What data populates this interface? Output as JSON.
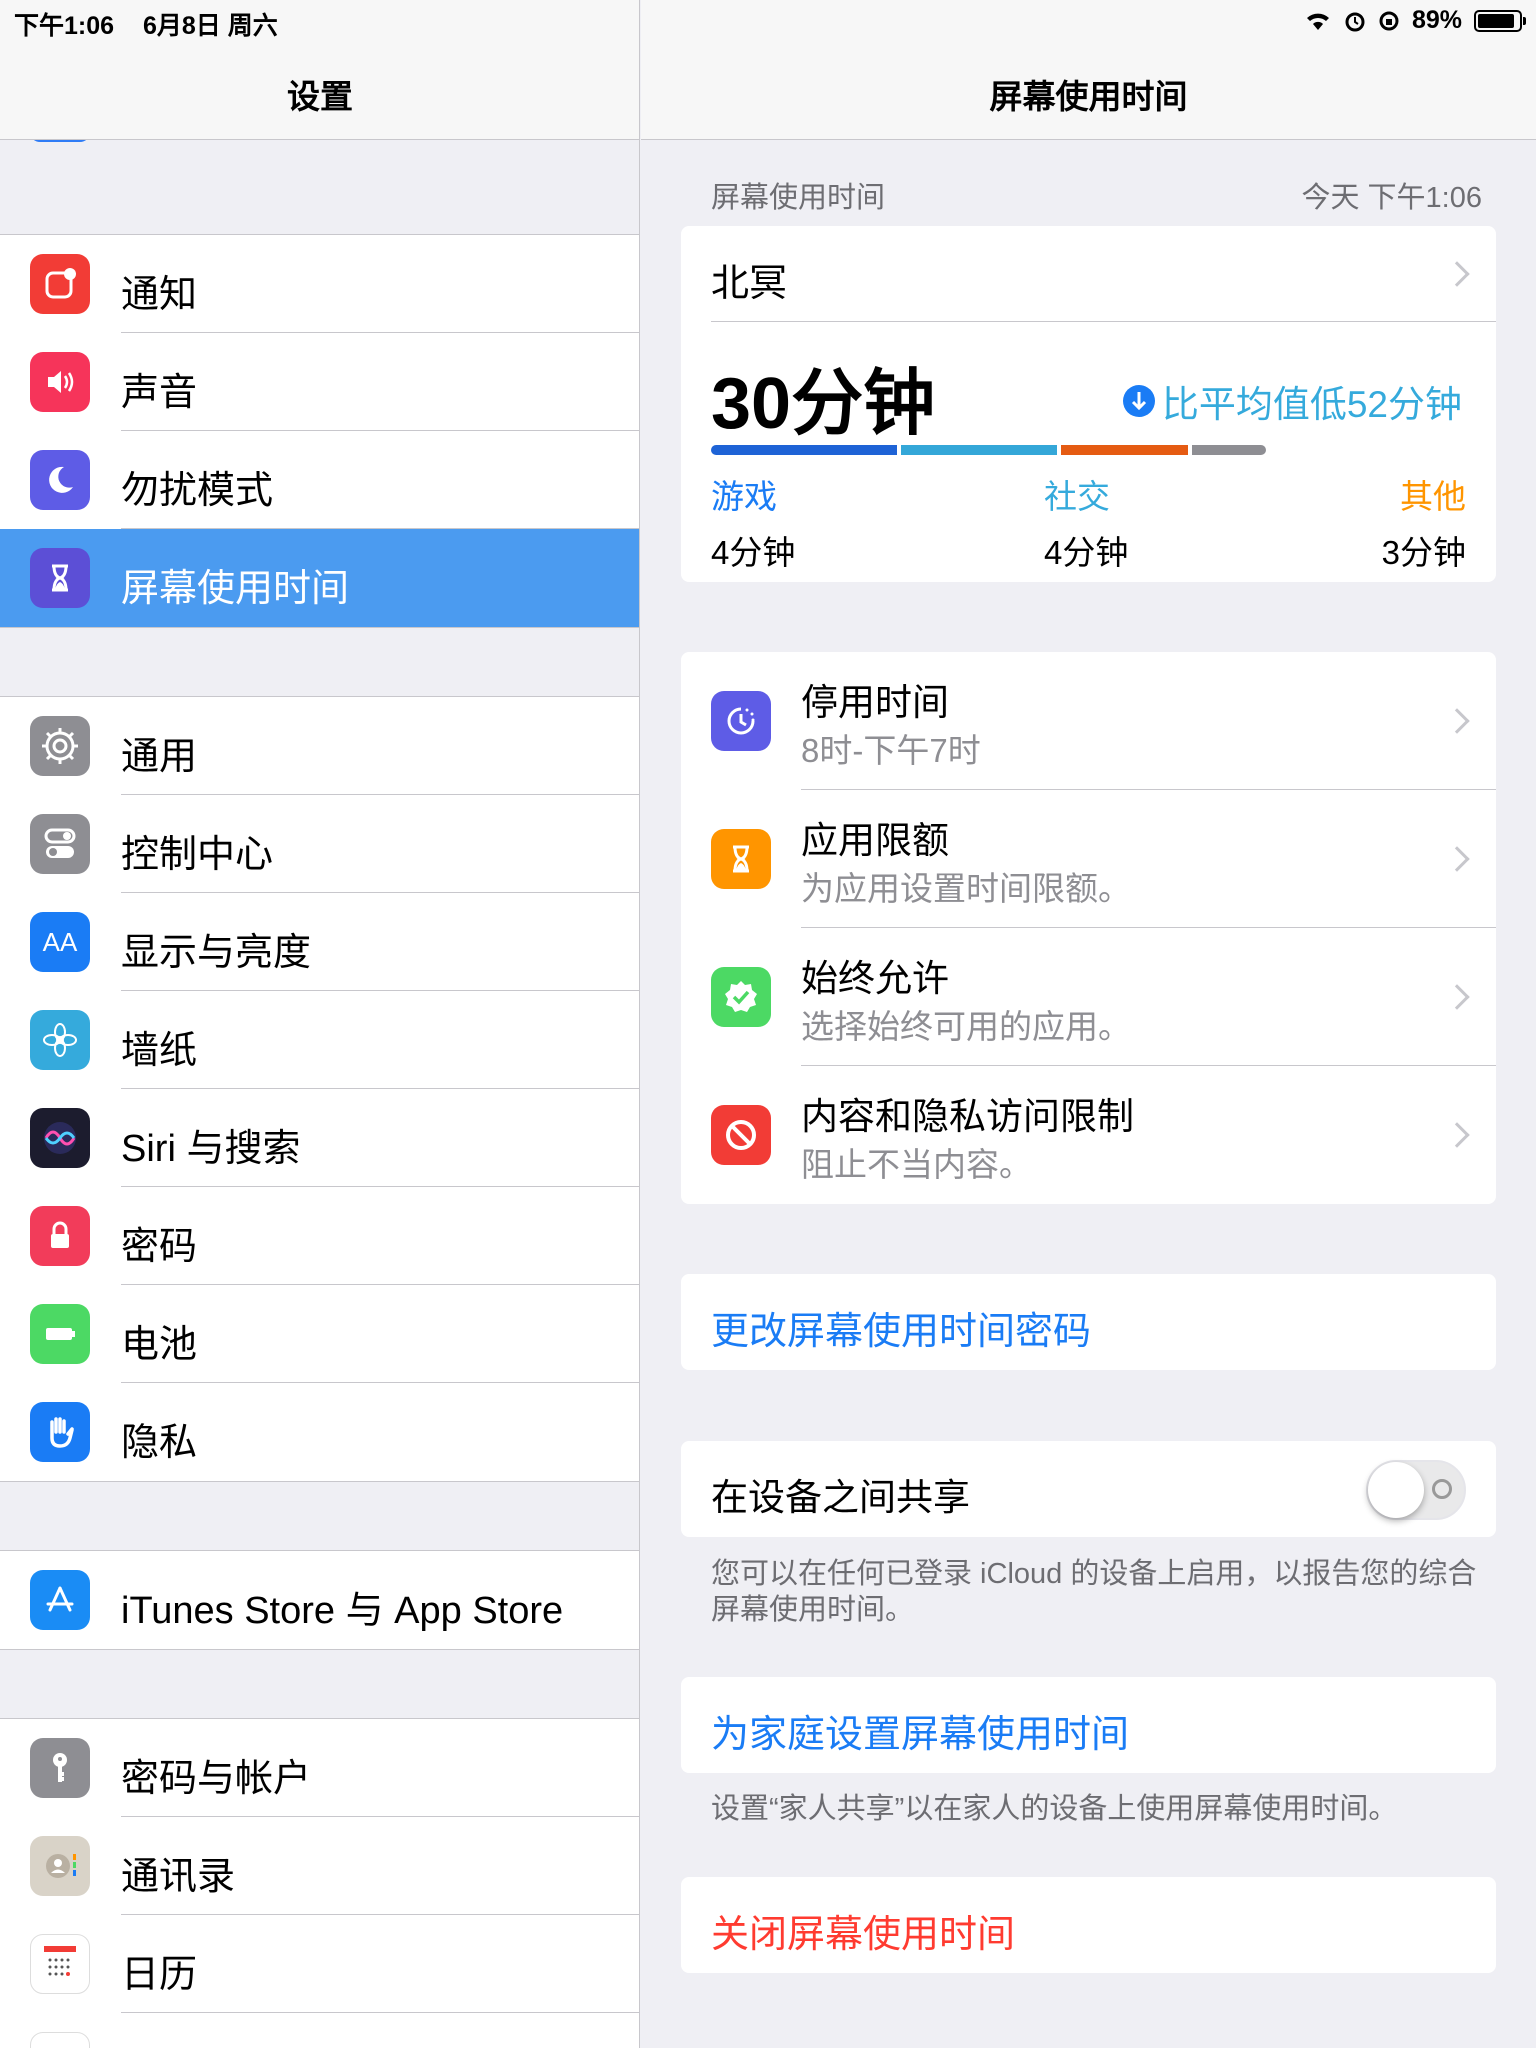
{
  "status": {
    "time": "下午1:06",
    "date": "6月8日 周六",
    "battery": "89%",
    "battery_level": 0.89
  },
  "master": {
    "title": "设置",
    "groups": [
      {
        "items": [
          {
            "label": "通知",
            "icon": "notifications-icon",
            "color": "#f23c36"
          },
          {
            "label": "声音",
            "icon": "sounds-icon",
            "color": "#f6345a"
          },
          {
            "label": "勿扰模式",
            "icon": "moon-icon",
            "color": "#5e5ce6"
          },
          {
            "label": "屏幕使用时间",
            "icon": "hourglass-icon",
            "color": "#5c4fd6"
          }
        ]
      },
      {
        "items": [
          {
            "label": "通用",
            "icon": "gear-icon",
            "color": "#8e8e93"
          },
          {
            "label": "控制中心",
            "icon": "toggles-icon",
            "color": "#8e8e93"
          },
          {
            "label": "显示与亮度",
            "icon": "text-size-icon",
            "color": "#1a7cf5"
          },
          {
            "label": "墙纸",
            "icon": "flower-icon",
            "color": "#35aadc"
          },
          {
            "label": "Siri 与搜索",
            "icon": "siri-icon",
            "color": "#222"
          },
          {
            "label": "密码",
            "icon": "lock-icon",
            "color": "#f23c5a"
          },
          {
            "label": "电池",
            "icon": "battery-icon",
            "color": "#4cd964"
          },
          {
            "label": "隐私",
            "icon": "hand-icon",
            "color": "#1a7cf5"
          }
        ]
      },
      {
        "items": [
          {
            "label": "iTunes Store 与 App Store",
            "icon": "app-store-icon",
            "color": "#1a8cf5"
          }
        ]
      },
      {
        "items": [
          {
            "label": "密码与帐户",
            "icon": "key-icon",
            "color": "#8e8e93"
          },
          {
            "label": "通讯录",
            "icon": "contacts-icon",
            "color": "#c9c1b4"
          },
          {
            "label": "日历",
            "icon": "calendar-icon",
            "color": "#ffffff"
          }
        ]
      }
    ]
  },
  "detail": {
    "title": "屏幕使用时间",
    "section_label": "屏幕使用时间",
    "section_date": "今天 下午1:06",
    "device_name": "北冥",
    "total": "30分钟",
    "compare": "比平均值低52分钟",
    "categories": [
      {
        "name": "游戏",
        "time": "4分钟",
        "color": "#1a7cf5"
      },
      {
        "name": "社交",
        "time": "4分钟",
        "color": "#35aadc"
      },
      {
        "name": "其他",
        "time": "3分钟",
        "color": "#ff9500"
      }
    ],
    "usage_bar": [
      {
        "share": 0.25,
        "color": "#1e63d6"
      },
      {
        "share": 0.21,
        "color": "#34a7d8"
      },
      {
        "share": 0.17,
        "color": "#e55b12"
      },
      {
        "share": 0.1,
        "color": "#8e8e93"
      }
    ],
    "options": [
      {
        "title": "停用时间",
        "subtitle": "8时-下午7时",
        "icon": "downtime-icon",
        "color": "#5e5ce6"
      },
      {
        "title": "应用限额",
        "subtitle": "为应用设置时间限额。",
        "icon": "hourglass-icon",
        "color": "#ff9500"
      },
      {
        "title": "始终允许",
        "subtitle": "选择始终可用的应用。",
        "icon": "checkmark-badge-icon",
        "color": "#4cd964"
      },
      {
        "title": "内容和隐私访问限制",
        "subtitle": "阻止不当内容。",
        "icon": "restricted-icon",
        "color": "#f23c36"
      }
    ],
    "change_passcode": "更改屏幕使用时间密码",
    "share_devices": "在设备之间共享",
    "share_note": "您可以在任何已登录 iCloud 的设备上启用，以报告您的综合屏幕使用时间。",
    "family_setup": "为家庭设置屏幕使用时间",
    "family_note": "设置“家人共享”以在家人的设备上使用屏幕使用时间。",
    "turn_off": "关闭屏幕使用时间"
  }
}
